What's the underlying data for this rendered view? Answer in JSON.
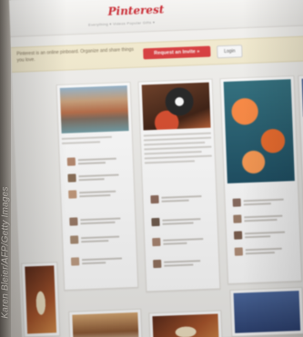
{
  "site": {
    "logo_text": "Pinterest",
    "nav_text": "Everything ▾ Videos Popular Gifts ▾",
    "brand_color": "#c8232c"
  },
  "banner": {
    "message": "Pinterest is an online pinboard. Organize and share things you love.",
    "request_invite_label": "Request an Invite »",
    "login_label": "Login",
    "button_color": "#d9393b"
  },
  "pins": [
    {
      "image": "venice-canal-image"
    },
    {
      "image": "black-cat-image"
    },
    {
      "image": "orange-fish-image"
    },
    {
      "image": "blue-image"
    },
    {
      "image": "food-plate-image"
    },
    {
      "image": "dessert-image"
    },
    {
      "image": "pizza-image"
    },
    {
      "image": "city-image"
    }
  ],
  "photo_credit": "Karen Bleier/AFP/Getty Images"
}
